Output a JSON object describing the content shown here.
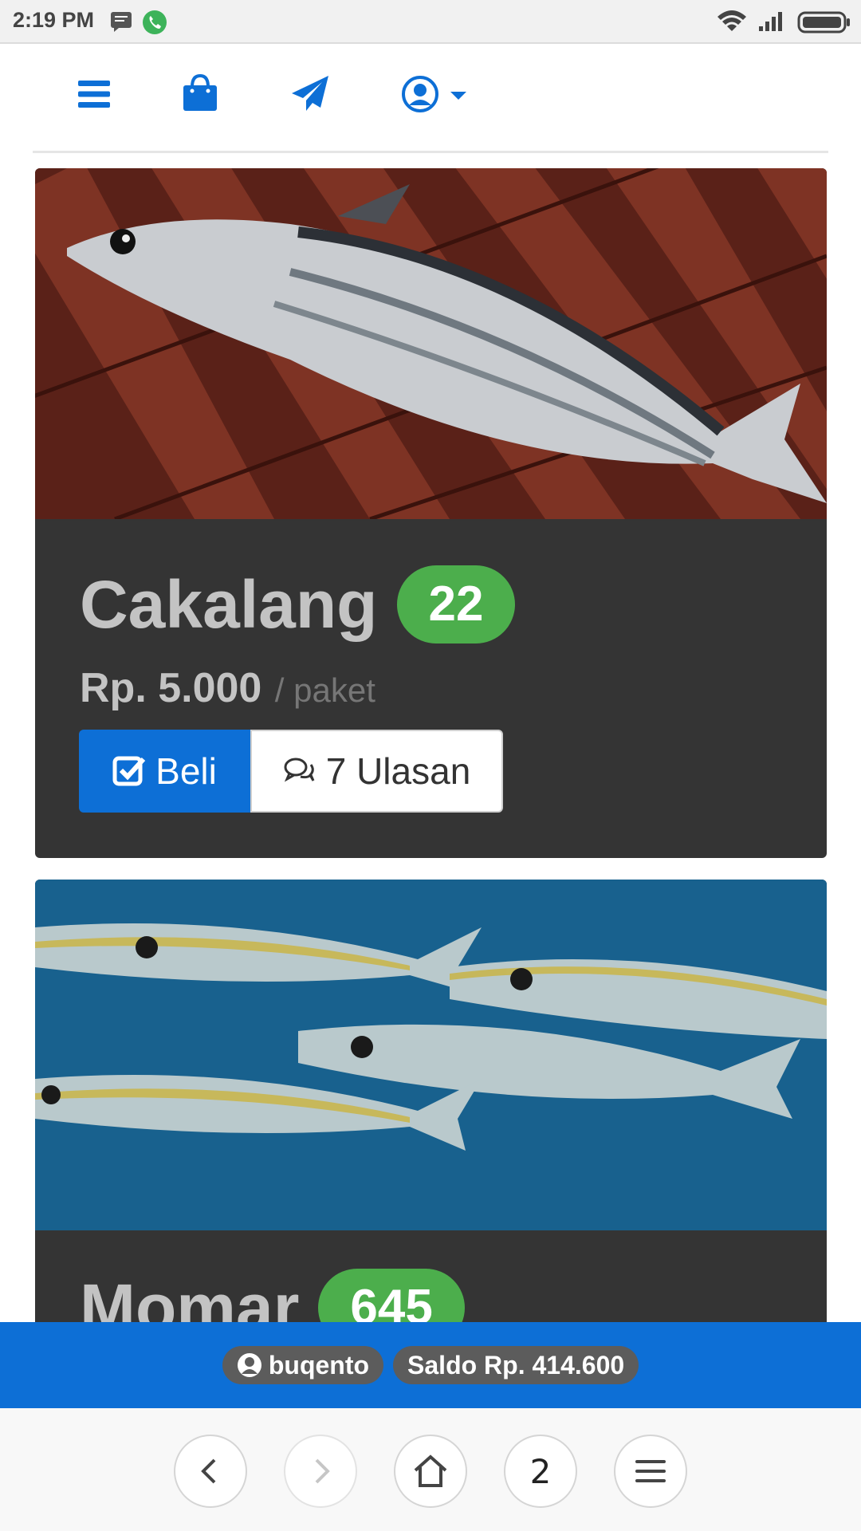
{
  "status_bar": {
    "time": "2:19 PM",
    "icons": [
      "message-icon",
      "phone-icon",
      "wifi-icon",
      "signal-icon",
      "battery-icon"
    ]
  },
  "nav": {
    "icons": [
      "menu-icon",
      "shopping-bag-icon",
      "paper-plane-icon",
      "user-circle-icon",
      "caret-down-icon"
    ],
    "accent": "#0d6fd6"
  },
  "products": [
    {
      "name": "Cakalang",
      "badge": "22",
      "price": "Rp. 5.000",
      "unit": "/ paket",
      "buy_label": "Beli",
      "review_label": "7 Ulasan"
    },
    {
      "name": "Momar",
      "badge": "645"
    }
  ],
  "footer_bar": {
    "username": "buqento",
    "balance": "Saldo Rp. 414.600"
  },
  "browser_toolbar": {
    "tab_count": "2",
    "icons": [
      "back-icon",
      "forward-icon",
      "home-icon",
      "tabs-counter",
      "menu-icon"
    ]
  },
  "colors": {
    "primary": "#0d6fd6",
    "badge": "#4cae4c",
    "card_bg": "#343434"
  }
}
